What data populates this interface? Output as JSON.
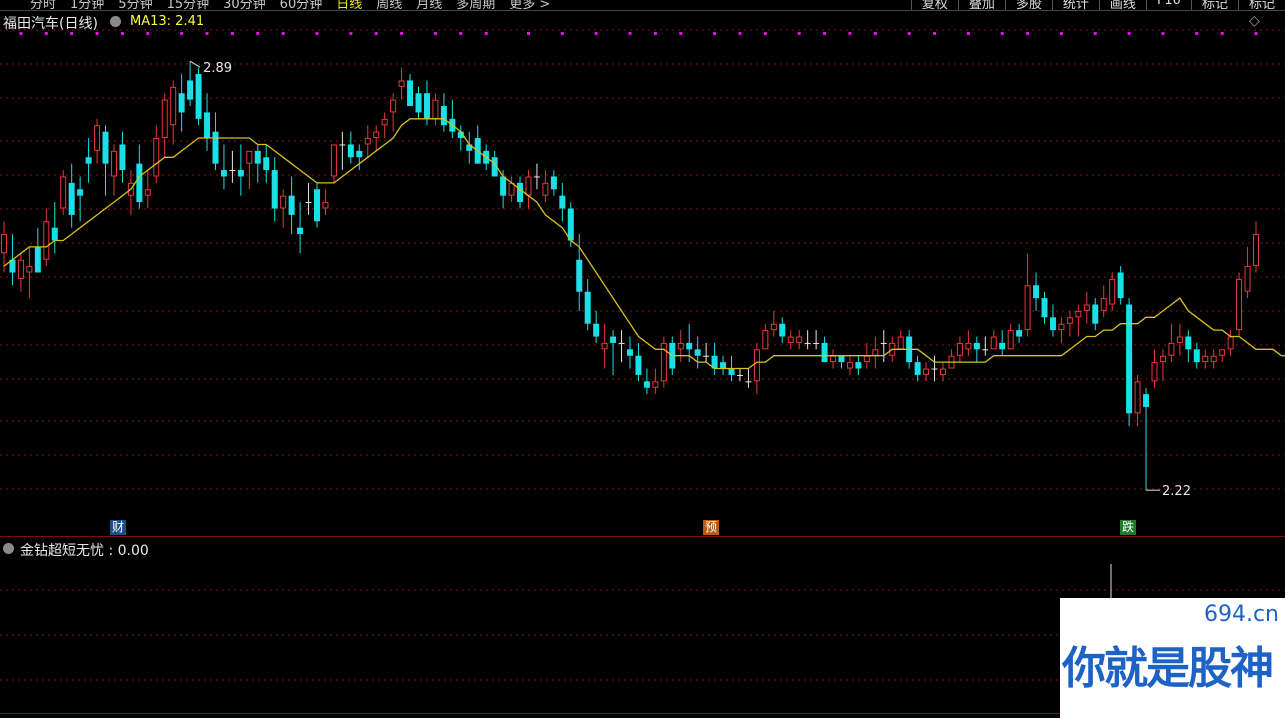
{
  "toolbar": {
    "period_tabs": [
      "分时",
      "1分钟",
      "5分钟",
      "15分钟",
      "30分钟",
      "60分钟",
      "日线",
      "周线",
      "月线",
      "多周期",
      "更多 >"
    ],
    "active_period": "日线",
    "right_buttons": [
      "复权",
      "叠加",
      "多股",
      "统计",
      "画线",
      "F10",
      "标记",
      "标记"
    ]
  },
  "stock": {
    "title": "福田汽车(日线)"
  },
  "ma": {
    "label": "MA13: 2.41"
  },
  "annotations": {
    "high_label": "2.89",
    "low_label": "2.22"
  },
  "tags": {
    "cai": "财",
    "yu": "预",
    "die": "跌"
  },
  "sub_indicator": {
    "title": "金钻超短无忧 : 0.00"
  },
  "watermark": {
    "url": "694.cn",
    "text": "你就是股神"
  },
  "colors": {
    "up": "#e8383a",
    "down": "#19e0e6",
    "doji": "#e6e6e6",
    "ma": "#d6c21a",
    "signal_dot": "#e013e6",
    "grid": "#8b1010"
  },
  "chart_data": {
    "type": "candlestick",
    "title": "福田汽车(日线)",
    "y_range": [
      2.15,
      2.97
    ],
    "price_high": 2.89,
    "price_low": 2.22,
    "ma13_last": 2.41,
    "series_ohlc": [
      [
        2.59,
        2.64,
        2.56,
        2.62
      ],
      [
        2.58,
        2.62,
        2.54,
        2.56
      ],
      [
        2.55,
        2.59,
        2.53,
        2.58
      ],
      [
        2.56,
        2.6,
        2.52,
        2.57
      ],
      [
        2.6,
        2.63,
        2.56,
        2.56
      ],
      [
        2.58,
        2.66,
        2.57,
        2.64
      ],
      [
        2.63,
        2.67,
        2.59,
        2.61
      ],
      [
        2.66,
        2.72,
        2.65,
        2.71
      ],
      [
        2.7,
        2.73,
        2.63,
        2.65
      ],
      [
        2.69,
        2.71,
        2.64,
        2.68
      ],
      [
        2.74,
        2.77,
        2.7,
        2.73
      ],
      [
        2.75,
        2.8,
        2.73,
        2.79
      ],
      [
        2.78,
        2.79,
        2.68,
        2.73
      ],
      [
        2.71,
        2.76,
        2.68,
        2.75
      ],
      [
        2.76,
        2.78,
        2.7,
        2.72
      ],
      [
        2.68,
        2.72,
        2.65,
        2.7
      ],
      [
        2.73,
        2.76,
        2.66,
        2.67
      ],
      [
        2.68,
        2.72,
        2.66,
        2.69
      ],
      [
        2.71,
        2.79,
        2.7,
        2.77
      ],
      [
        2.77,
        2.84,
        2.74,
        2.83
      ],
      [
        2.79,
        2.86,
        2.76,
        2.85
      ],
      [
        2.84,
        2.87,
        2.78,
        2.81
      ],
      [
        2.86,
        2.89,
        2.82,
        2.83
      ],
      [
        2.87,
        2.88,
        2.79,
        2.8
      ],
      [
        2.81,
        2.84,
        2.75,
        2.77
      ],
      [
        2.78,
        2.81,
        2.72,
        2.73
      ],
      [
        2.72,
        2.76,
        2.69,
        2.71
      ],
      [
        2.72,
        2.75,
        2.7,
        2.72
      ],
      [
        2.72,
        2.76,
        2.68,
        2.71
      ],
      [
        2.73,
        2.75,
        2.69,
        2.75
      ],
      [
        2.75,
        2.76,
        2.7,
        2.73
      ],
      [
        2.74,
        2.76,
        2.7,
        2.72
      ],
      [
        2.72,
        2.74,
        2.64,
        2.66
      ],
      [
        2.66,
        2.69,
        2.63,
        2.68
      ],
      [
        2.68,
        2.71,
        2.62,
        2.65
      ],
      [
        2.63,
        2.67,
        2.59,
        2.62
      ],
      [
        2.67,
        2.7,
        2.65,
        2.67
      ],
      [
        2.69,
        2.7,
        2.63,
        2.64
      ],
      [
        2.66,
        2.69,
        2.65,
        2.67
      ],
      [
        2.71,
        2.76,
        2.7,
        2.76
      ],
      [
        2.76,
        2.78,
        2.72,
        2.76
      ],
      [
        2.76,
        2.78,
        2.73,
        2.74
      ],
      [
        2.75,
        2.76,
        2.72,
        2.74
      ],
      [
        2.76,
        2.79,
        2.74,
        2.77
      ],
      [
        2.77,
        2.79,
        2.75,
        2.78
      ],
      [
        2.79,
        2.81,
        2.77,
        2.8
      ],
      [
        2.81,
        2.84,
        2.78,
        2.83
      ],
      [
        2.85,
        2.88,
        2.83,
        2.86
      ],
      [
        2.86,
        2.87,
        2.82,
        2.82
      ],
      [
        2.84,
        2.85,
        2.8,
        2.81
      ],
      [
        2.84,
        2.86,
        2.79,
        2.8
      ],
      [
        2.8,
        2.84,
        2.79,
        2.83
      ],
      [
        2.82,
        2.84,
        2.78,
        2.79
      ],
      [
        2.8,
        2.83,
        2.77,
        2.78
      ],
      [
        2.78,
        2.79,
        2.75,
        2.77
      ],
      [
        2.76,
        2.78,
        2.73,
        2.75
      ],
      [
        2.77,
        2.79,
        2.73,
        2.73
      ],
      [
        2.75,
        2.76,
        2.72,
        2.73
      ],
      [
        2.74,
        2.75,
        2.71,
        2.71
      ],
      [
        2.71,
        2.72,
        2.66,
        2.68
      ],
      [
        2.68,
        2.71,
        2.67,
        2.7
      ],
      [
        2.7,
        2.71,
        2.66,
        2.67
      ],
      [
        2.68,
        2.72,
        2.66,
        2.71
      ],
      [
        2.71,
        2.73,
        2.69,
        2.71
      ],
      [
        2.68,
        2.72,
        2.67,
        2.7
      ],
      [
        2.71,
        2.72,
        2.68,
        2.69
      ],
      [
        2.68,
        2.7,
        2.64,
        2.66
      ],
      [
        2.66,
        2.67,
        2.6,
        2.61
      ],
      [
        2.58,
        2.62,
        2.5,
        2.53
      ],
      [
        2.53,
        2.55,
        2.47,
        2.48
      ],
      [
        2.48,
        2.5,
        2.45,
        2.46
      ],
      [
        2.44,
        2.48,
        2.41,
        2.45
      ],
      [
        2.46,
        2.47,
        2.4,
        2.45
      ],
      [
        2.45,
        2.47,
        2.42,
        2.45
      ],
      [
        2.44,
        2.46,
        2.41,
        2.43
      ],
      [
        2.43,
        2.45,
        2.39,
        2.4
      ],
      [
        2.39,
        2.41,
        2.37,
        2.38
      ],
      [
        2.38,
        2.41,
        2.37,
        2.39
      ],
      [
        2.39,
        2.46,
        2.38,
        2.45
      ],
      [
        2.45,
        2.46,
        2.4,
        2.41
      ],
      [
        2.44,
        2.47,
        2.42,
        2.45
      ],
      [
        2.45,
        2.48,
        2.42,
        2.44
      ],
      [
        2.44,
        2.46,
        2.41,
        2.43
      ],
      [
        2.43,
        2.45,
        2.42,
        2.43
      ],
      [
        2.43,
        2.45,
        2.4,
        2.41
      ],
      [
        2.42,
        2.43,
        2.4,
        2.41
      ],
      [
        2.41,
        2.43,
        2.39,
        2.4
      ],
      [
        2.4,
        2.41,
        2.39,
        2.4
      ],
      [
        2.39,
        2.41,
        2.38,
        2.39
      ],
      [
        2.39,
        2.45,
        2.37,
        2.44
      ],
      [
        2.44,
        2.48,
        2.44,
        2.47
      ],
      [
        2.47,
        2.5,
        2.46,
        2.48
      ],
      [
        2.48,
        2.49,
        2.45,
        2.46
      ],
      [
        2.45,
        2.47,
        2.44,
        2.46
      ],
      [
        2.45,
        2.47,
        2.44,
        2.46
      ],
      [
        2.45,
        2.47,
        2.44,
        2.45
      ],
      [
        2.45,
        2.47,
        2.44,
        2.45
      ],
      [
        2.45,
        2.46,
        2.42,
        2.42
      ],
      [
        2.42,
        2.44,
        2.41,
        2.43
      ],
      [
        2.43,
        2.43,
        2.41,
        2.42
      ],
      [
        2.41,
        2.43,
        2.4,
        2.42
      ],
      [
        2.42,
        2.43,
        2.4,
        2.41
      ],
      [
        2.42,
        2.45,
        2.41,
        2.43
      ],
      [
        2.43,
        2.46,
        2.41,
        2.44
      ],
      [
        2.45,
        2.47,
        2.42,
        2.45
      ],
      [
        2.43,
        2.46,
        2.42,
        2.45
      ],
      [
        2.44,
        2.47,
        2.44,
        2.46
      ],
      [
        2.46,
        2.47,
        2.41,
        2.42
      ],
      [
        2.42,
        2.43,
        2.39,
        2.4
      ],
      [
        2.4,
        2.42,
        2.39,
        2.41
      ],
      [
        2.41,
        2.43,
        2.39,
        2.41
      ],
      [
        2.4,
        2.42,
        2.39,
        2.41
      ],
      [
        2.41,
        2.44,
        2.41,
        2.43
      ],
      [
        2.43,
        2.46,
        2.42,
        2.45
      ],
      [
        2.44,
        2.47,
        2.43,
        2.45
      ],
      [
        2.45,
        2.46,
        2.42,
        2.44
      ],
      [
        2.44,
        2.46,
        2.43,
        2.44
      ],
      [
        2.44,
        2.47,
        2.44,
        2.46
      ],
      [
        2.45,
        2.47,
        2.43,
        2.44
      ],
      [
        2.44,
        2.48,
        2.44,
        2.47
      ],
      [
        2.47,
        2.48,
        2.45,
        2.46
      ],
      [
        2.47,
        2.59,
        2.46,
        2.54
      ],
      [
        2.54,
        2.56,
        2.5,
        2.52
      ],
      [
        2.52,
        2.53,
        2.48,
        2.49
      ],
      [
        2.49,
        2.51,
        2.46,
        2.47
      ],
      [
        2.47,
        2.49,
        2.45,
        2.48
      ],
      [
        2.48,
        2.5,
        2.46,
        2.49
      ],
      [
        2.49,
        2.51,
        2.46,
        2.5
      ],
      [
        2.5,
        2.53,
        2.48,
        2.51
      ],
      [
        2.51,
        2.52,
        2.47,
        2.48
      ],
      [
        2.5,
        2.54,
        2.49,
        2.52
      ],
      [
        2.51,
        2.56,
        2.5,
        2.55
      ],
      [
        2.56,
        2.57,
        2.51,
        2.52
      ],
      [
        2.51,
        2.52,
        2.32,
        2.34
      ],
      [
        2.34,
        2.4,
        2.32,
        2.39
      ],
      [
        2.37,
        2.38,
        2.22,
        2.35
      ],
      [
        2.39,
        2.44,
        2.38,
        2.42
      ],
      [
        2.42,
        2.44,
        2.39,
        2.43
      ],
      [
        2.43,
        2.48,
        2.42,
        2.45
      ],
      [
        2.45,
        2.48,
        2.43,
        2.46
      ],
      [
        2.46,
        2.47,
        2.42,
        2.44
      ],
      [
        2.44,
        2.45,
        2.41,
        2.42
      ],
      [
        2.42,
        2.44,
        2.41,
        2.43
      ],
      [
        2.42,
        2.44,
        2.41,
        2.43
      ],
      [
        2.43,
        2.44,
        2.42,
        2.44
      ],
      [
        2.44,
        2.47,
        2.43,
        2.46
      ],
      [
        2.47,
        2.56,
        2.46,
        2.55
      ],
      [
        2.53,
        2.6,
        2.52,
        2.57
      ],
      [
        2.57,
        2.64,
        2.56,
        2.62
      ]
    ],
    "ma13": [
      2.57,
      2.58,
      2.59,
      2.6,
      2.6,
      2.6,
      2.61,
      2.61,
      2.62,
      2.63,
      2.64,
      2.65,
      2.66,
      2.67,
      2.68,
      2.69,
      2.71,
      2.72,
      2.73,
      2.74,
      2.74,
      2.75,
      2.76,
      2.77,
      2.77,
      2.77,
      2.77,
      2.77,
      2.77,
      2.77,
      2.76,
      2.76,
      2.75,
      2.74,
      2.73,
      2.72,
      2.71,
      2.7,
      2.7,
      2.7,
      2.71,
      2.72,
      2.73,
      2.74,
      2.75,
      2.76,
      2.77,
      2.79,
      2.8,
      2.8,
      2.8,
      2.8,
      2.8,
      2.79,
      2.78,
      2.76,
      2.75,
      2.74,
      2.73,
      2.71,
      2.7,
      2.69,
      2.68,
      2.67,
      2.65,
      2.64,
      2.63,
      2.61,
      2.6,
      2.58,
      2.56,
      2.54,
      2.52,
      2.5,
      2.48,
      2.46,
      2.45,
      2.44,
      2.44,
      2.43,
      2.43,
      2.43,
      2.42,
      2.42,
      2.41,
      2.41,
      2.41,
      2.41,
      2.41,
      2.42,
      2.42,
      2.43,
      2.43,
      2.43,
      2.43,
      2.43,
      2.43,
      2.43,
      2.43,
      2.43,
      2.43,
      2.43,
      2.43,
      2.43,
      2.43,
      2.44,
      2.44,
      2.44,
      2.44,
      2.43,
      2.42,
      2.42,
      2.42,
      2.42,
      2.42,
      2.42,
      2.42,
      2.43,
      2.43,
      2.43,
      2.43,
      2.43,
      2.43,
      2.43,
      2.43,
      2.43,
      2.44,
      2.45,
      2.46,
      2.46,
      2.47,
      2.47,
      2.48,
      2.48,
      2.48,
      2.49,
      2.49,
      2.5,
      2.51,
      2.52,
      2.5,
      2.49,
      2.48,
      2.47,
      2.47,
      2.46,
      2.46,
      2.45,
      2.44,
      2.44,
      2.44,
      2.43,
      2.43,
      2.43,
      2.43,
      2.44
    ]
  }
}
